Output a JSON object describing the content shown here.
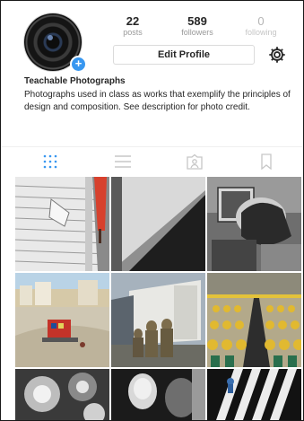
{
  "profile": {
    "stats": [
      {
        "count": "22",
        "label": "posts"
      },
      {
        "count": "589",
        "label": "followers"
      },
      {
        "count": "0",
        "label": "following"
      }
    ],
    "edit_label": "Edit Profile",
    "name": "Teachable Photographs",
    "bio": "Photographs used in class as works that exemplify the principles of design and composition. See description for photo credit."
  },
  "tabs": [
    {
      "icon": "grid-icon",
      "active": true
    },
    {
      "icon": "list-icon",
      "active": false
    },
    {
      "icon": "tagged-icon",
      "active": false
    },
    {
      "icon": "bookmark-icon",
      "active": false
    }
  ],
  "colors": {
    "accent": "#3897f0",
    "active_tab": "#3897f0",
    "inactive_tab": "#c7c7c7"
  }
}
